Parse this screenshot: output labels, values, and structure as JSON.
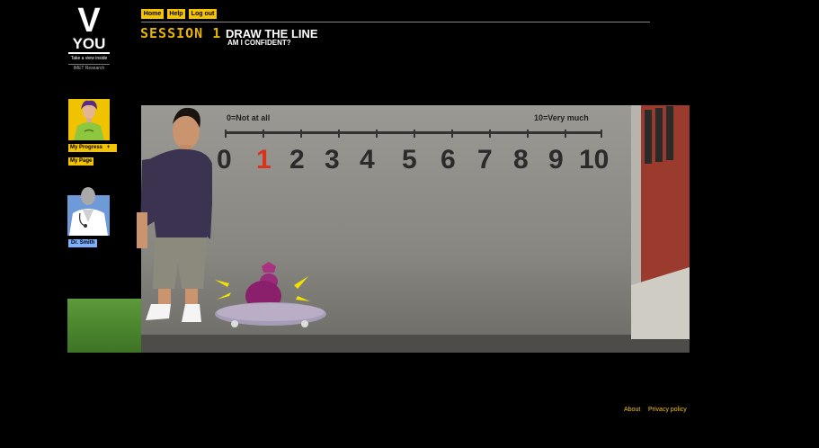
{
  "logo": {
    "letter": "V",
    "word": "YOU",
    "tagline": "Take a view inside",
    "org": "iMET Research"
  },
  "nav": {
    "home": "Home",
    "help": "Help",
    "logout": "Log out"
  },
  "header": {
    "session": "SESSION 1",
    "title": "DRAW THE LINE",
    "subtitle": "AM I CONFIDENT?"
  },
  "sidebar": {
    "progress": "My Progress",
    "progress_icon": "+",
    "my_page": "My Page",
    "doctor": "Dr. Smith"
  },
  "scale": {
    "min_label": "0=Not at all",
    "max_label": "10=Very much",
    "numbers": [
      "0",
      "1",
      "2",
      "3",
      "4",
      "5",
      "6",
      "7",
      "8",
      "9",
      "10"
    ],
    "highlighted": "1",
    "highlight_color": "#d9341b"
  },
  "footer": {
    "about": "About",
    "privacy": "Privacy policy"
  },
  "colors": {
    "accent": "#f5c400",
    "session": "#e7b400",
    "doctor_tag": "#7fb0ff"
  }
}
